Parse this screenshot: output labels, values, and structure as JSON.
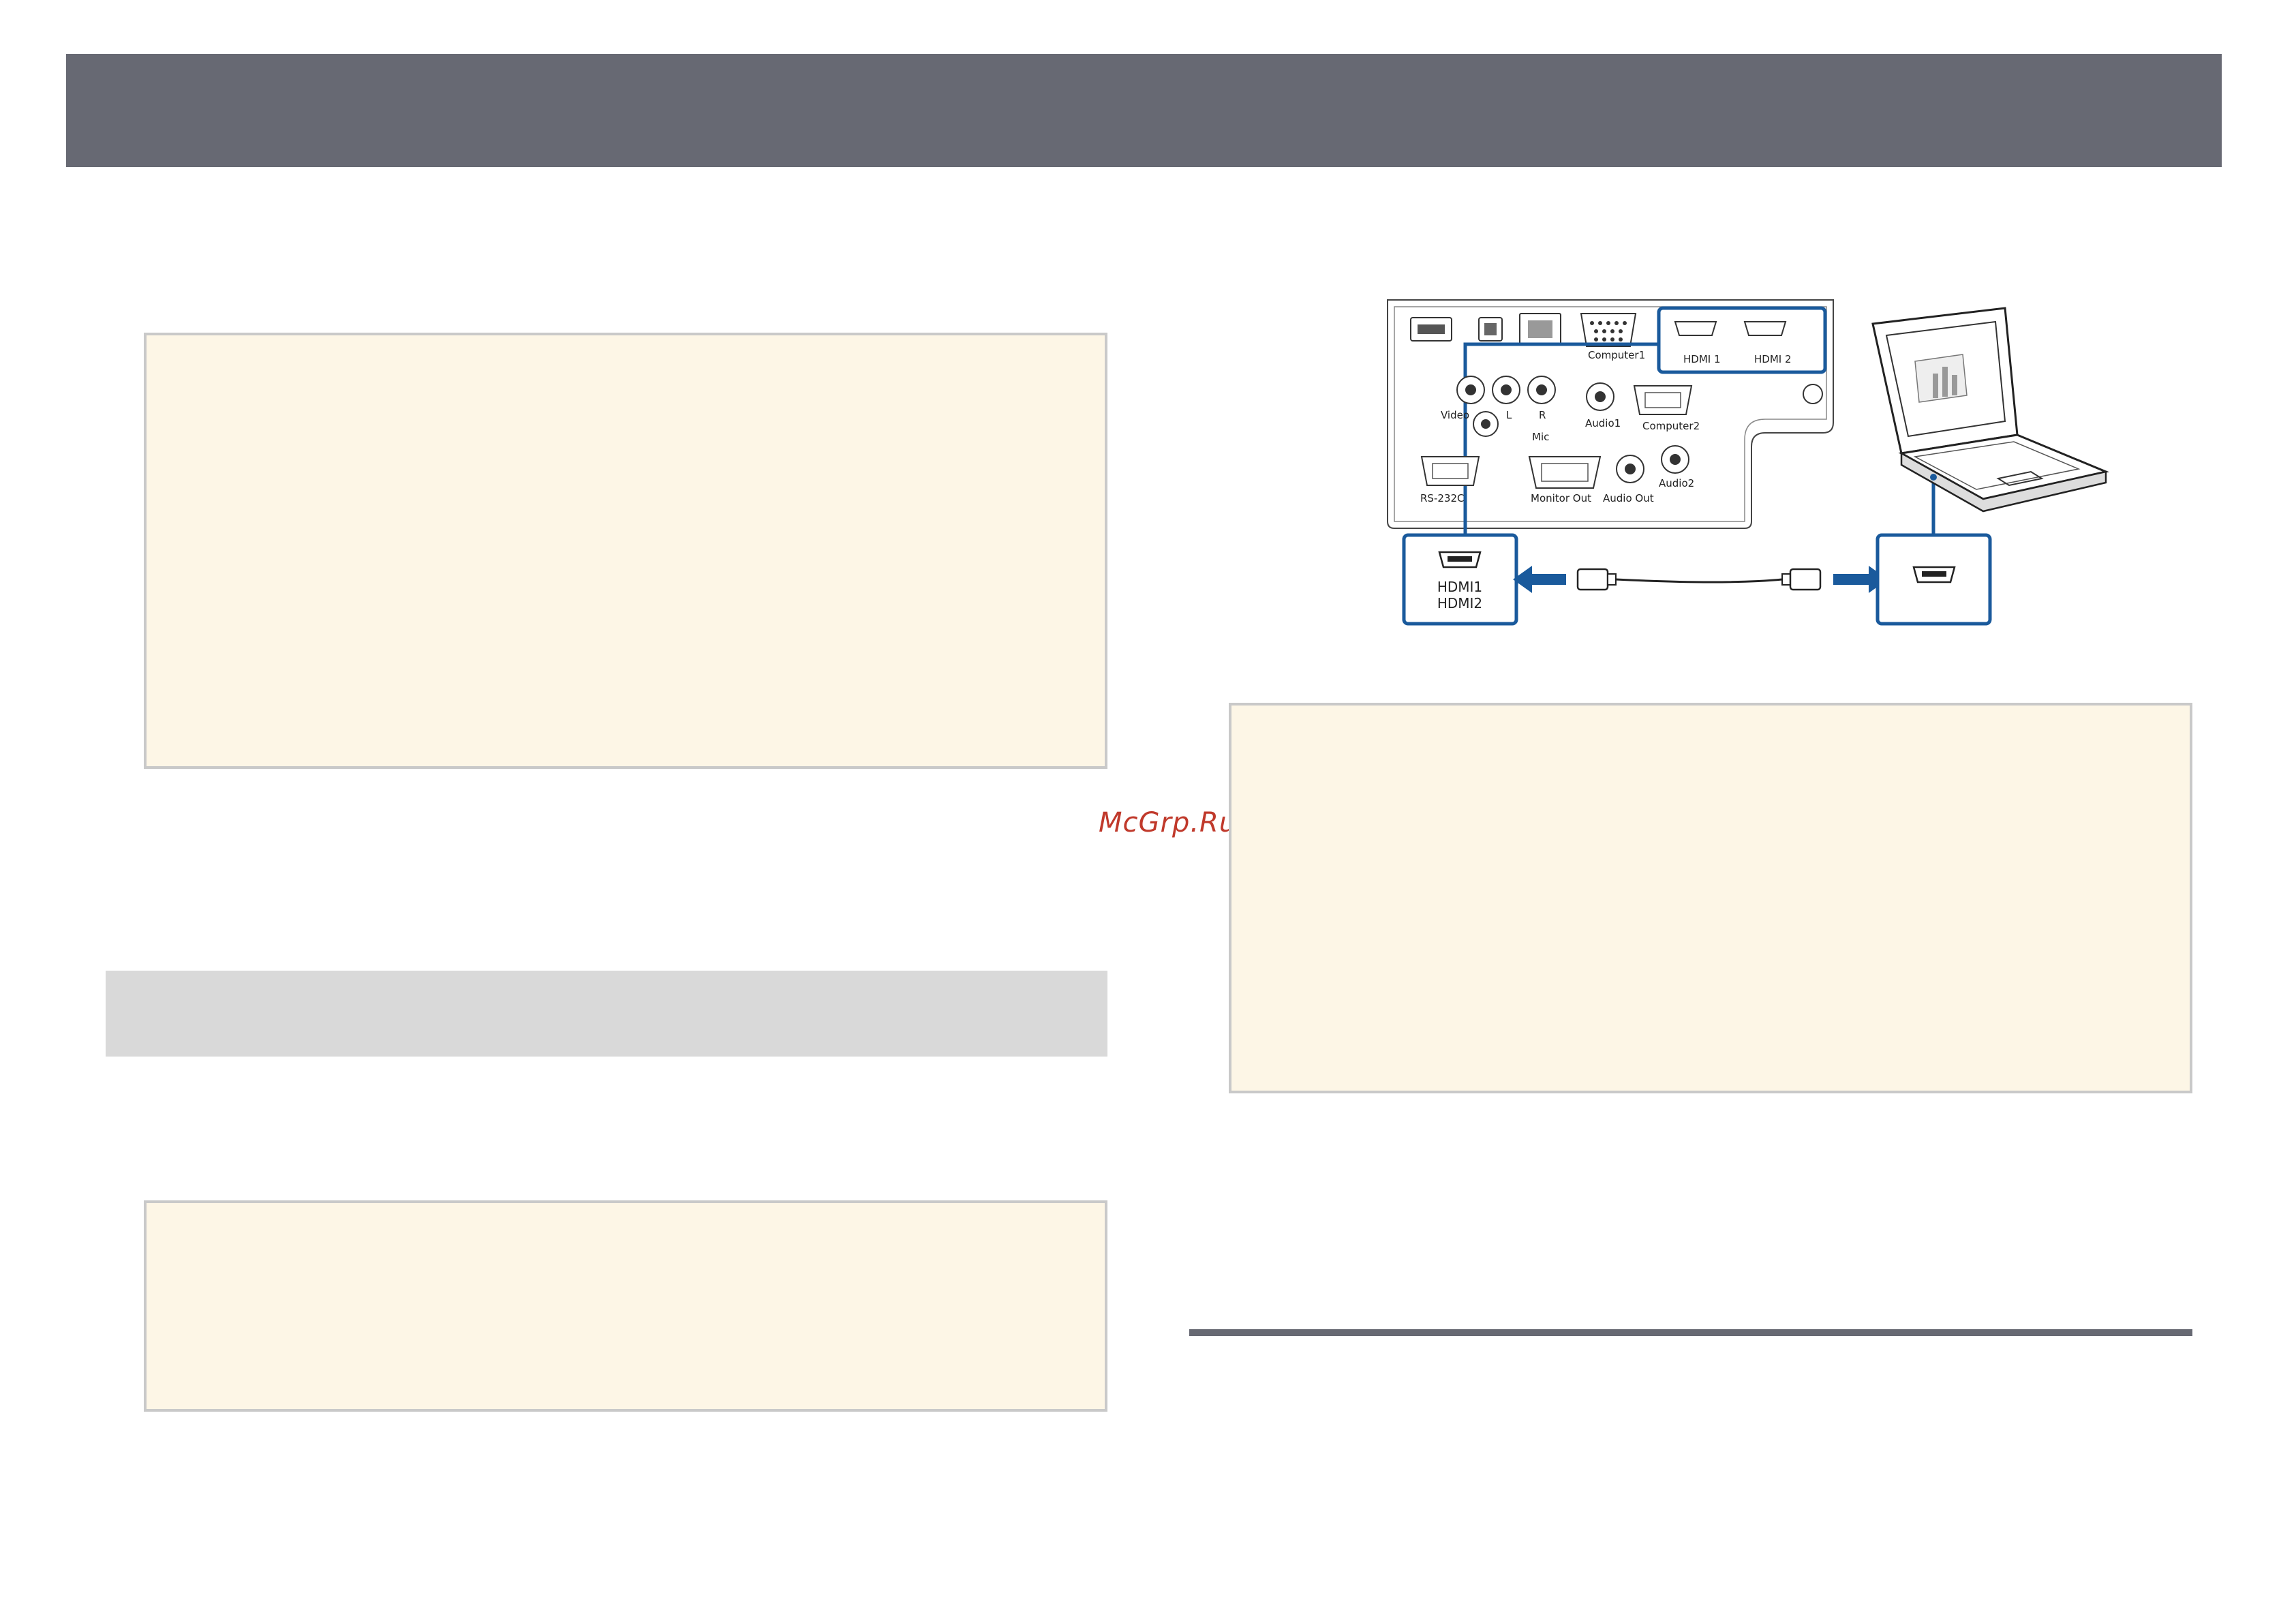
{
  "watermark": "McGrp.Ru",
  "diagram": {
    "projector_ports": [
      "Computer1",
      "HDMI 1",
      "HDMI 2",
      "Video",
      "L",
      "R",
      "Mic",
      "Audio1",
      "Computer2",
      "RS-232C",
      "Monitor Out",
      "Audio Out",
      "Audio2"
    ],
    "callout_left": [
      "HDMI1",
      "HDMI2"
    ],
    "accent_color": "#1a5a9c"
  },
  "icons": [
    "hdmi-port-icon",
    "usb-port-icon",
    "lan-port-icon",
    "vga-port-icon",
    "laptop-icon",
    "arrow-left-icon",
    "arrow-right-icon",
    "hdmi-cable-icon"
  ]
}
